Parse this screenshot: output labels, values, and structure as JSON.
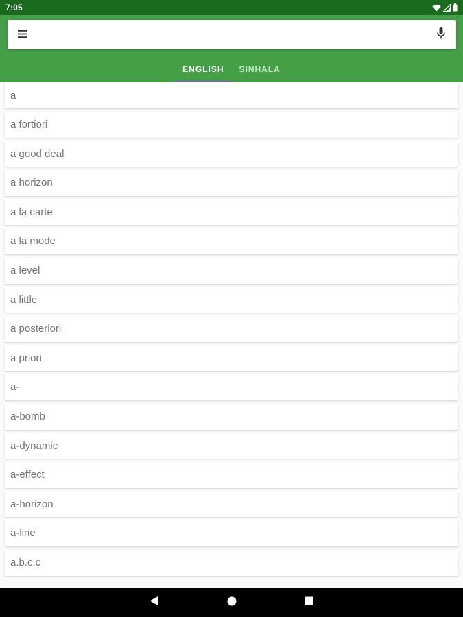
{
  "status_bar": {
    "time": "7:05",
    "icons": [
      "wifi-icon",
      "signal-icon",
      "battery-icon"
    ]
  },
  "colors": {
    "status_bar": "#1b6b1e",
    "app_bar": "#43a047",
    "tab_indicator": "#7e57c2",
    "word_text": "#757575"
  },
  "search": {
    "value": "",
    "placeholder": "",
    "menu_icon": "menu-icon",
    "mic_icon": "mic-icon"
  },
  "tabs": [
    {
      "label": "ENGLISH",
      "active": true
    },
    {
      "label": "SINHALA",
      "active": false
    }
  ],
  "words": [
    "a",
    "a fortiori",
    "a good deal",
    "a horizon",
    "a la carte",
    "a la mode",
    "a level",
    "a little",
    "a posteriori",
    "a priori",
    "a-",
    "a-bomb",
    "a-dynamic",
    "a-effect",
    "a-horizon",
    "a-line",
    "a.b.c.c"
  ],
  "nav_bar": {
    "buttons": [
      "back-icon",
      "home-icon",
      "recents-icon"
    ]
  }
}
